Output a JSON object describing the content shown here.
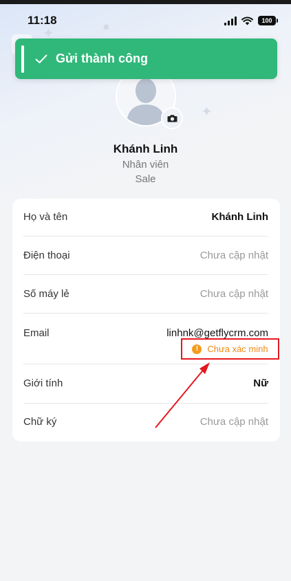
{
  "status_bar": {
    "time": "11:18",
    "battery": "100"
  },
  "toast": {
    "message": "Gửi thành công"
  },
  "profile": {
    "name": "Khánh Linh",
    "role": "Nhân viên",
    "department": "Sale"
  },
  "fields": [
    {
      "label": "Họ và tên",
      "value": "Khánh Linh"
    },
    {
      "label": "Điện thoại",
      "value": "Chưa cập nhật"
    },
    {
      "label": "Số máy lẻ",
      "value": "Chưa cập nhật"
    },
    {
      "label": "Email",
      "value": "linhnk@getflycrm.com",
      "badge": "Chưa xác minh"
    },
    {
      "label": "Giới tính",
      "value": "Nữ"
    },
    {
      "label": "Chữ ký",
      "value": "Chưa cập nhật"
    }
  ],
  "colors": {
    "toast_bg": "#2fb87a",
    "warning": "#f08a12",
    "annotation": "#e5181f",
    "placeholder_text": "#999999"
  },
  "icons": [
    "signal-icon",
    "wifi-icon",
    "battery-icon",
    "check-icon",
    "camera-icon",
    "info-icon"
  ]
}
